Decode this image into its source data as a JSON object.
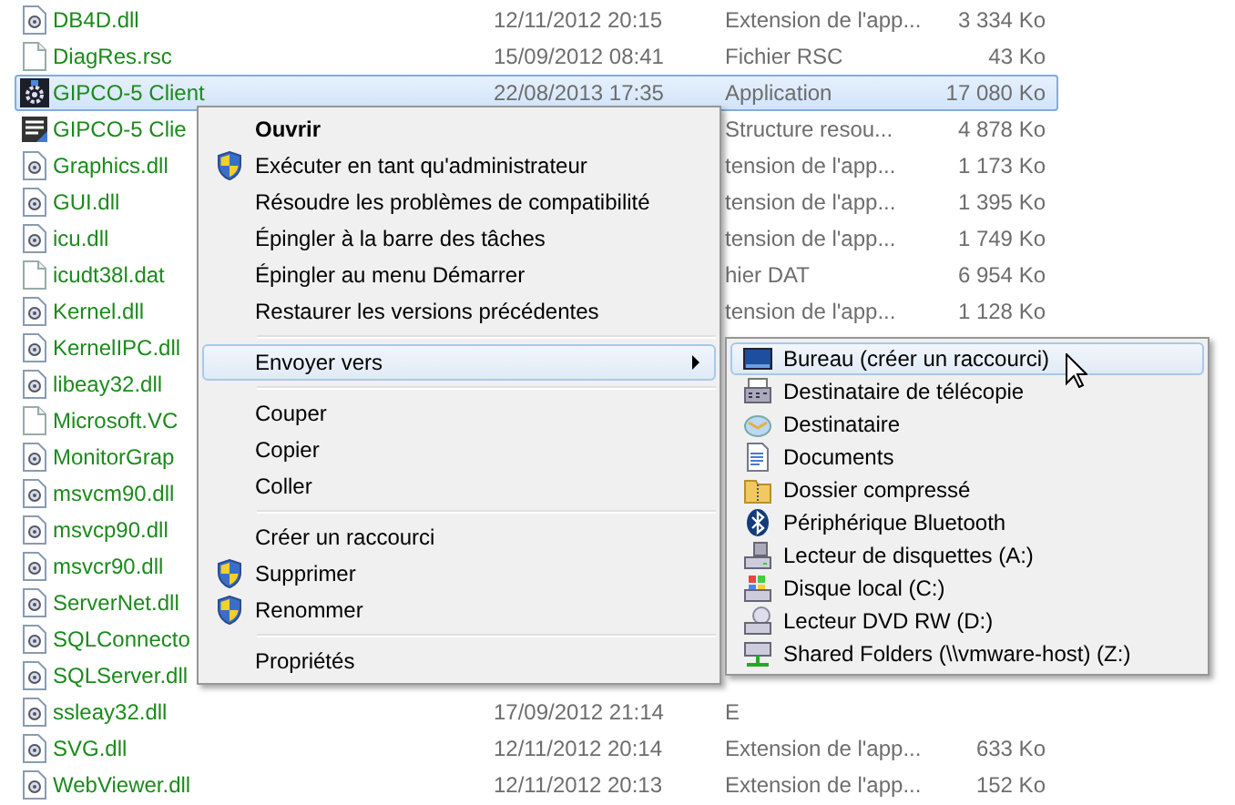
{
  "files": [
    {
      "kind": "dll",
      "name": "DB4D.dll",
      "date": "12/11/2012 20:15",
      "type": "Extension de l'app...",
      "size": "3 334 Ko",
      "selected": false
    },
    {
      "kind": "blank",
      "name": "DiagRes.rsc",
      "date": "15/09/2012 08:41",
      "type": "Fichier RSC",
      "size": "43 Ko",
      "selected": false
    },
    {
      "kind": "app",
      "name": "GIPCO-5 Client",
      "date": "22/08/2013 17:35",
      "type": "Application",
      "size": "17 080 Ko",
      "selected": true
    },
    {
      "kind": "resource",
      "name": "GIPCO-5 Clie",
      "type": "Structure resou...",
      "size": "4 878 Ko",
      "selected": false
    },
    {
      "kind": "dll",
      "name": "Graphics.dll",
      "type": "tension de l'app...",
      "size": "1 173 Ko",
      "selected": false
    },
    {
      "kind": "dll",
      "name": "GUI.dll",
      "type": "tension de l'app...",
      "size": "1 395 Ko",
      "selected": false
    },
    {
      "kind": "dll",
      "name": "icu.dll",
      "type": "tension de l'app...",
      "size": "1 749 Ko",
      "selected": false
    },
    {
      "kind": "blank",
      "name": "icudt38l.dat",
      "type": "hier DAT",
      "size": "6 954 Ko",
      "selected": false
    },
    {
      "kind": "dll",
      "name": "Kernel.dll",
      "type": "tension de l'app...",
      "size": "1 128 Ko",
      "selected": false
    },
    {
      "kind": "dll",
      "name": "KernelIPC.dll",
      "selected": false
    },
    {
      "kind": "dll",
      "name": "libeay32.dll",
      "selected": false
    },
    {
      "kind": "blank",
      "name": "Microsoft.VC",
      "selected": false
    },
    {
      "kind": "dll",
      "name": "MonitorGrap",
      "selected": false
    },
    {
      "kind": "dll",
      "name": "msvcm90.dll",
      "selected": false
    },
    {
      "kind": "dll",
      "name": "msvcp90.dll",
      "selected": false
    },
    {
      "kind": "dll",
      "name": "msvcr90.dll",
      "selected": false
    },
    {
      "kind": "dll",
      "name": "ServerNet.dll",
      "selected": false
    },
    {
      "kind": "dll",
      "name": "SQLConnecto",
      "selected": false
    },
    {
      "kind": "dll",
      "name": "SQLServer.dll",
      "selected": false
    },
    {
      "kind": "dll",
      "name": "ssleay32.dll",
      "date": "17/09/2012 21:14",
      "type": "E",
      "selected": false
    },
    {
      "kind": "dll",
      "name": "SVG.dll",
      "date": "12/11/2012 20:14",
      "type": "Extension de l'app...",
      "size": "633 Ko",
      "selected": false
    },
    {
      "kind": "dll",
      "name": "WebViewer.dll",
      "date": "12/11/2012 20:13",
      "type": "Extension de l'app...",
      "size": "152 Ko",
      "selected": false
    }
  ],
  "context_menu": {
    "items": [
      {
        "kind": "item",
        "label": "Ouvrir",
        "shield": false,
        "default": true,
        "selected": false
      },
      {
        "kind": "item",
        "label": "Exécuter en tant qu'administrateur",
        "shield": true,
        "default": false,
        "selected": false
      },
      {
        "kind": "item",
        "label": "Résoudre les problèmes de compatibilité",
        "shield": false,
        "default": false,
        "selected": false
      },
      {
        "kind": "item",
        "label": "Épingler à la barre des tâches",
        "shield": false,
        "default": false,
        "selected": false
      },
      {
        "kind": "item",
        "label": "Épingler au menu Démarrer",
        "shield": false,
        "default": false,
        "selected": false
      },
      {
        "kind": "item",
        "label": "Restaurer les versions précédentes",
        "shield": false,
        "default": false,
        "selected": false
      },
      {
        "kind": "separator"
      },
      {
        "kind": "submenu",
        "label": "Envoyer vers",
        "shield": false,
        "default": false,
        "selected": true
      },
      {
        "kind": "separator"
      },
      {
        "kind": "item",
        "label": "Couper",
        "shield": false,
        "default": false,
        "selected": false
      },
      {
        "kind": "item",
        "label": "Copier",
        "shield": false,
        "default": false,
        "selected": false
      },
      {
        "kind": "item",
        "label": "Coller",
        "shield": false,
        "default": false,
        "selected": false
      },
      {
        "kind": "separator"
      },
      {
        "kind": "item",
        "label": "Créer un raccourci",
        "shield": false,
        "default": false,
        "selected": false
      },
      {
        "kind": "item",
        "label": "Supprimer",
        "shield": true,
        "default": false,
        "selected": false
      },
      {
        "kind": "item",
        "label": "Renommer",
        "shield": true,
        "default": false,
        "selected": false
      },
      {
        "kind": "separator"
      },
      {
        "kind": "item",
        "label": "Propriétés",
        "shield": false,
        "default": false,
        "selected": false
      }
    ]
  },
  "send_to_menu": {
    "items": [
      {
        "kind": "desktop",
        "label": "Bureau (créer un raccourci)",
        "selected": true
      },
      {
        "kind": "fax",
        "label": "Destinataire de télécopie",
        "selected": false
      },
      {
        "kind": "mail",
        "label": "Destinataire",
        "selected": false
      },
      {
        "kind": "documents",
        "label": "Documents",
        "selected": false
      },
      {
        "kind": "zip",
        "label": "Dossier compressé",
        "selected": false
      },
      {
        "kind": "bluetooth",
        "label": "Périphérique Bluetooth",
        "selected": false
      },
      {
        "kind": "floppy",
        "label": "Lecteur de disquettes (A:)",
        "selected": false
      },
      {
        "kind": "disk",
        "label": "Disque local (C:)",
        "selected": false
      },
      {
        "kind": "dvd",
        "label": "Lecteur DVD RW (D:)",
        "selected": false
      },
      {
        "kind": "network",
        "label": "Shared Folders (\\\\vmware-host) (Z:)",
        "selected": false
      }
    ]
  }
}
